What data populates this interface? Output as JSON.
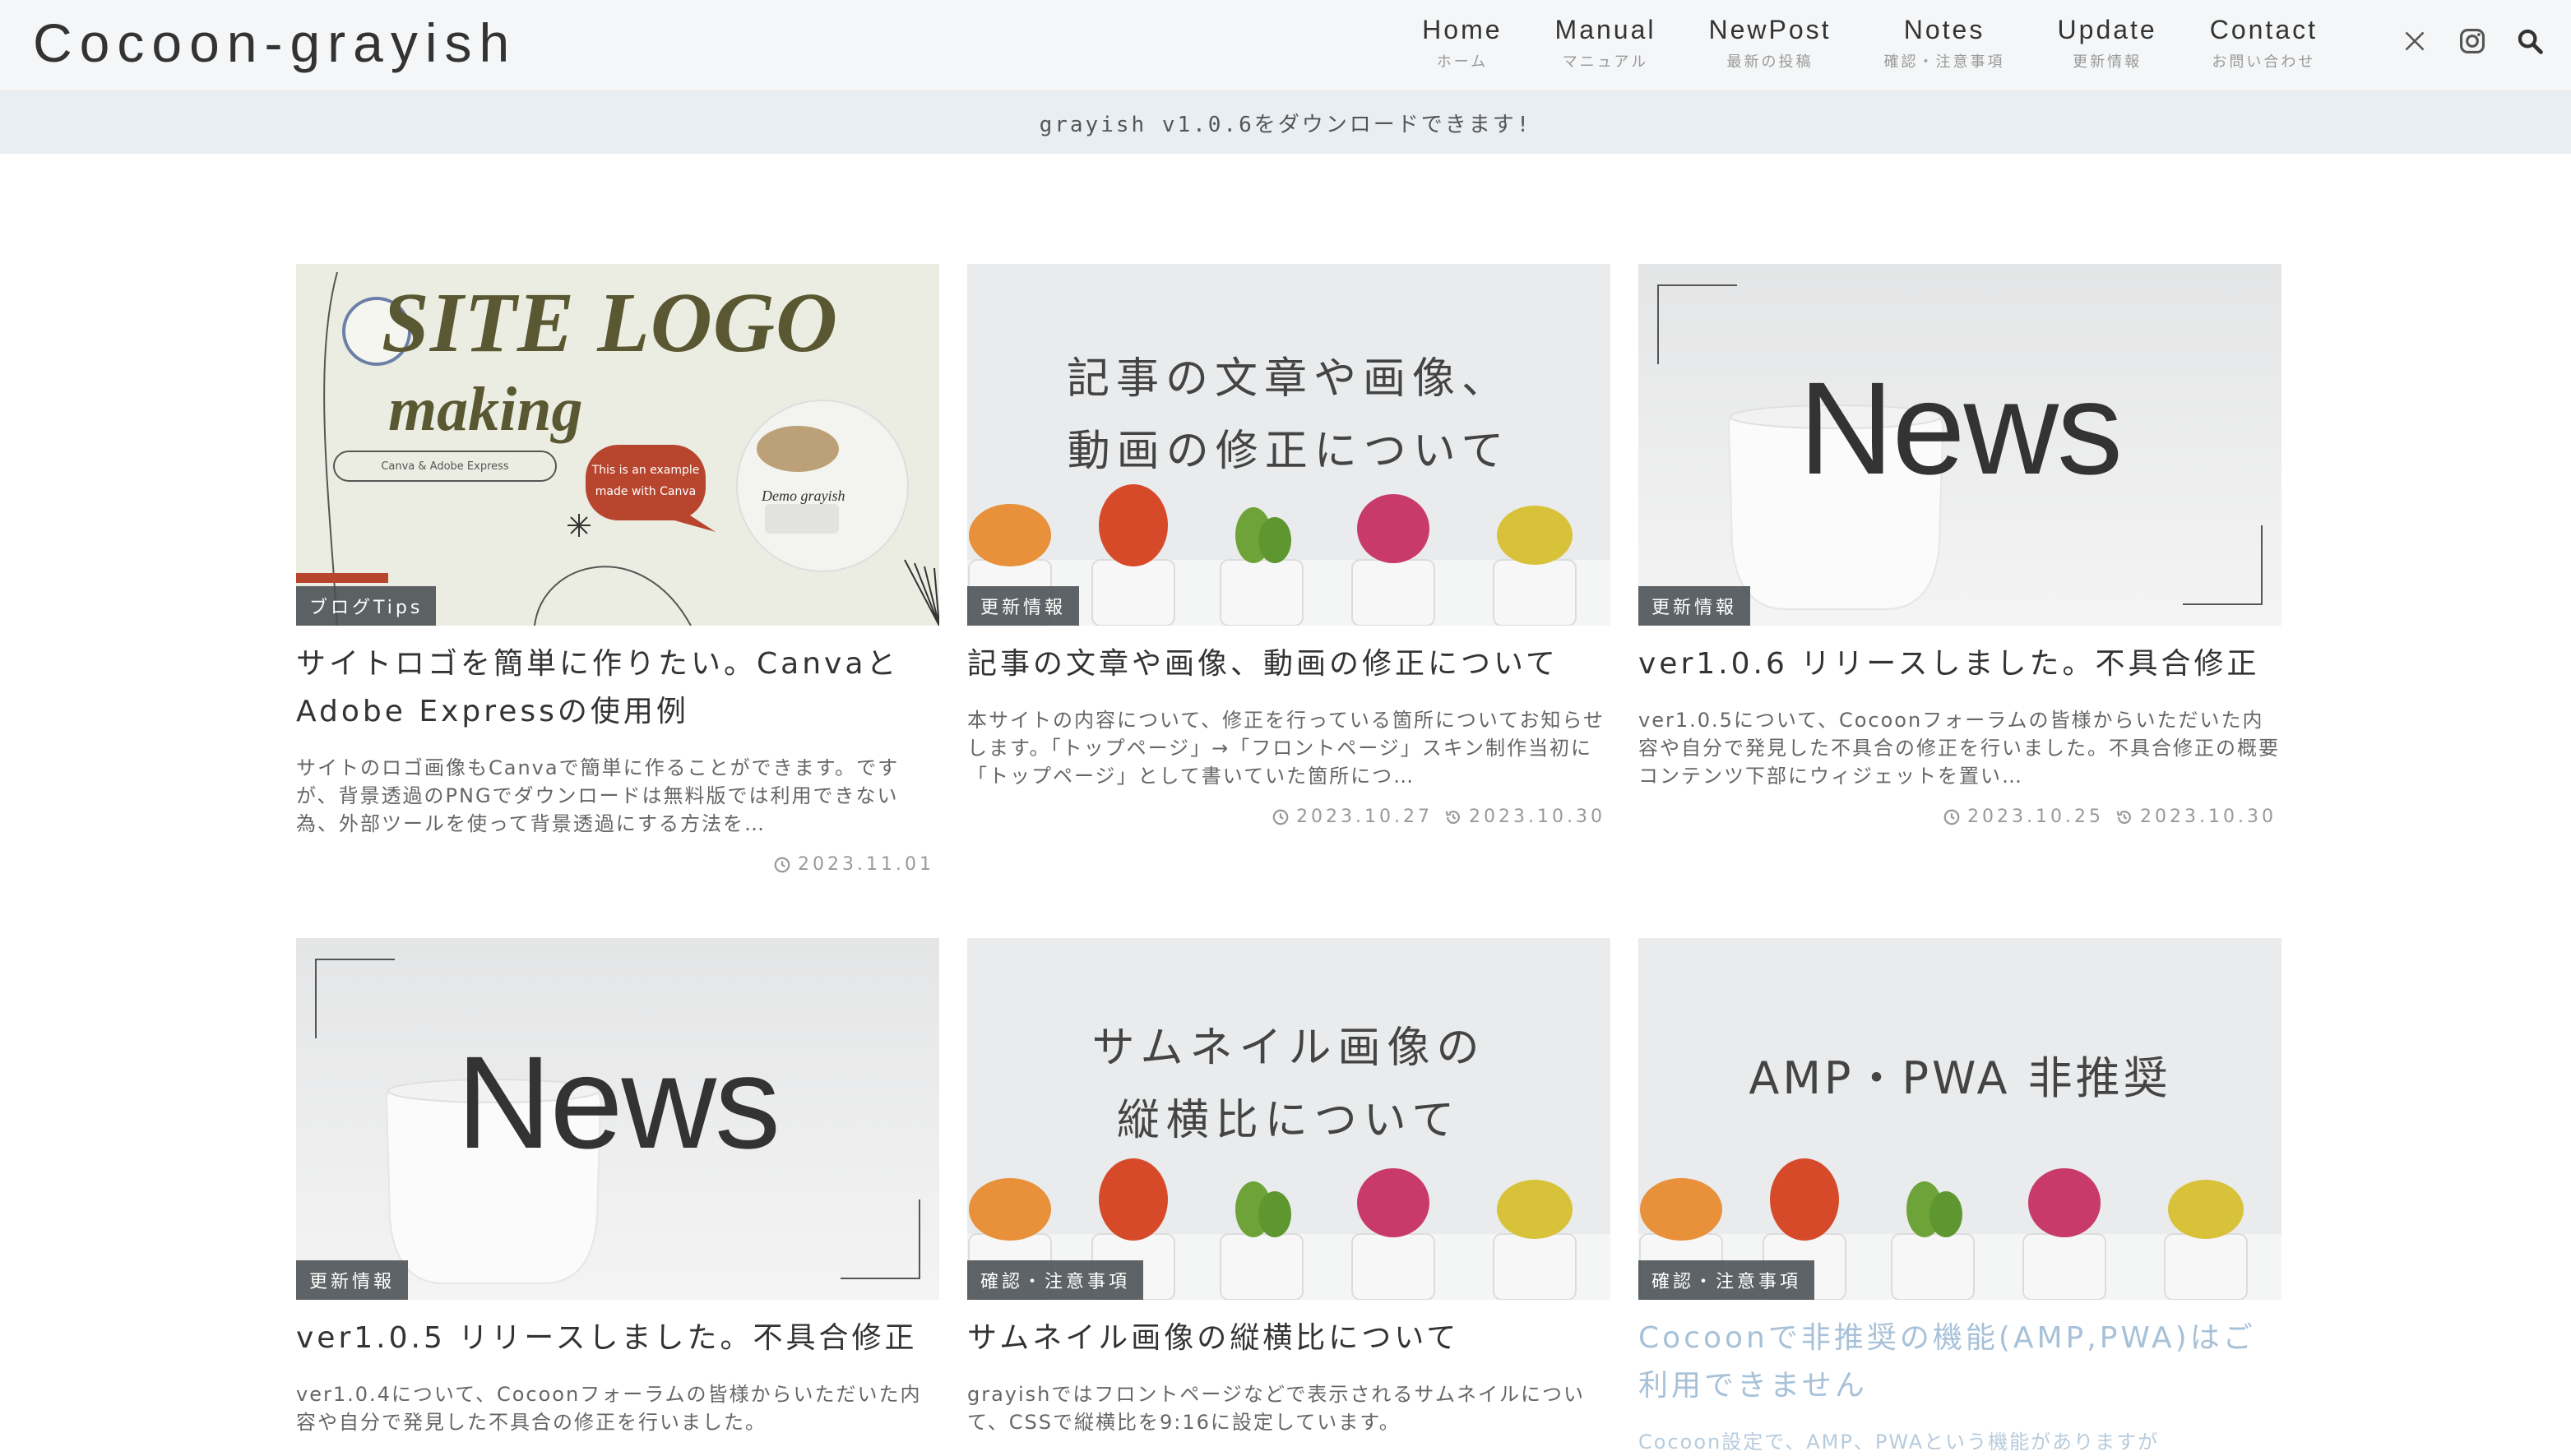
{
  "site": {
    "title": "Cocoon-grayish"
  },
  "nav": [
    {
      "label": "Home",
      "sub": "ホーム"
    },
    {
      "label": "Manual",
      "sub": "マニュアル"
    },
    {
      "label": "NewPost",
      "sub": "最新の投稿"
    },
    {
      "label": "Notes",
      "sub": "確認・注意事項"
    },
    {
      "label": "Update",
      "sub": "更新情報"
    },
    {
      "label": "Contact",
      "sub": "お問い合わせ"
    }
  ],
  "header_icons": [
    "x-icon",
    "instagram-icon",
    "search-icon"
  ],
  "notice": {
    "text": "grayish v1.0.6をダウンロードできます!"
  },
  "cards": [
    {
      "thumb_type": "logo",
      "thumb_text": {
        "line1": "SITE LOGO",
        "line2": "making",
        "pill": "Canva & Adobe Express",
        "bubble1": "This is an example",
        "bubble2": "made with Canva",
        "demo": "Demo grayish"
      },
      "category": "ブログTips",
      "title": "サイトロゴを簡単に作りたい。CanvaとAdobe Expressの使用例",
      "excerpt": "サイトのロゴ画像もCanvaで簡単に作ることができます。ですが、背景透過のPNGでダウンロードは無料版では利用できない為、外部ツールを使って背景透過にする方法を…",
      "date": "2023.11.01",
      "updated": ""
    },
    {
      "thumb_type": "cactus",
      "thumb_text": {
        "line1": "記事の文章や画像、",
        "line2": "動画の修正について"
      },
      "category": "更新情報",
      "title": "記事の文章や画像、動画の修正について",
      "excerpt": "本サイトの内容について、修正を行っている箇所についてお知らせします。「トップページ」→「フロントページ」スキン制作当初に「トップページ」として書いていた箇所につ…",
      "date": "2023.10.27",
      "updated": "2023.10.30"
    },
    {
      "thumb_type": "news",
      "thumb_text": {
        "line1": "News"
      },
      "category": "更新情報",
      "title": "ver1.0.6 リリースしました。不具合修正",
      "excerpt": "ver1.0.5について、Cocoonフォーラムの皆様からいただいた内容や自分で発見した不具合の修正を行いました。不具合修正の概要 コンテンツ下部にウィジェットを置い…",
      "date": "2023.10.25",
      "updated": "2023.10.30"
    },
    {
      "thumb_type": "news",
      "thumb_text": {
        "line1": "News"
      },
      "category": "更新情報",
      "title": "ver1.0.5 リリースしました。不具合修正",
      "excerpt": "ver1.0.4について、Cocoonフォーラムの皆様からいただいた内容や自分で発見した不具合の修正を行いました。",
      "date": "",
      "updated": ""
    },
    {
      "thumb_type": "cactus",
      "thumb_text": {
        "line1": "サムネイル画像の",
        "line2": "縦横比について"
      },
      "category": "確認・注意事項",
      "title": "サムネイル画像の縦横比について",
      "excerpt": "grayishではフロントページなどで表示されるサムネイルについて、CSSで縦横比を9:16に設定しています。",
      "date": "",
      "updated": ""
    },
    {
      "thumb_type": "cactus",
      "thumb_text": {
        "line1": "AMP・PWA 非推奨",
        "line2": ""
      },
      "category": "確認・注意事項",
      "title": "Cocoonで非推奨の機能(AMP,PWA)はご利用できません",
      "excerpt": "Cocoon設定で、AMP、PWAという機能がありますが",
      "date": "",
      "updated": ""
    }
  ],
  "colors": {
    "header_bg": "#f5f6f7",
    "notice_bg": "#e9eef3",
    "category_badge": "#484e52",
    "hover_title": "#a7c1d8"
  }
}
